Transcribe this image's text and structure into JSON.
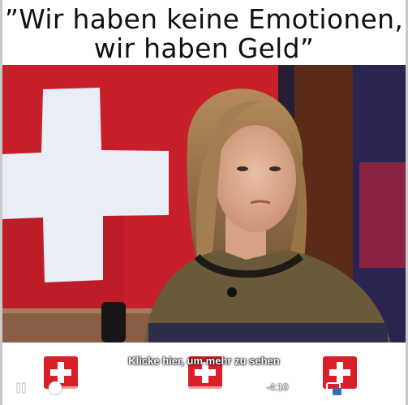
{
  "caption": {
    "line1": "”Wir haben keine Emotionen,",
    "line2": "wir haben Geld”"
  },
  "overlay": {
    "cta_text": "Klicke hier, um mehr zu sehen",
    "flag_icon": "swiss-flag-icon"
  },
  "player": {
    "time_remaining": "-4:10",
    "progress_fraction": 0.03,
    "accent_color": "#4267b2",
    "icons": [
      "pause-icon",
      "settings-icon",
      "miniplayer-icon",
      "fullscreen-icon",
      "volume-icon"
    ]
  },
  "colors": {
    "flag_red": "#d8202b",
    "flag_white": "#ffffff"
  }
}
